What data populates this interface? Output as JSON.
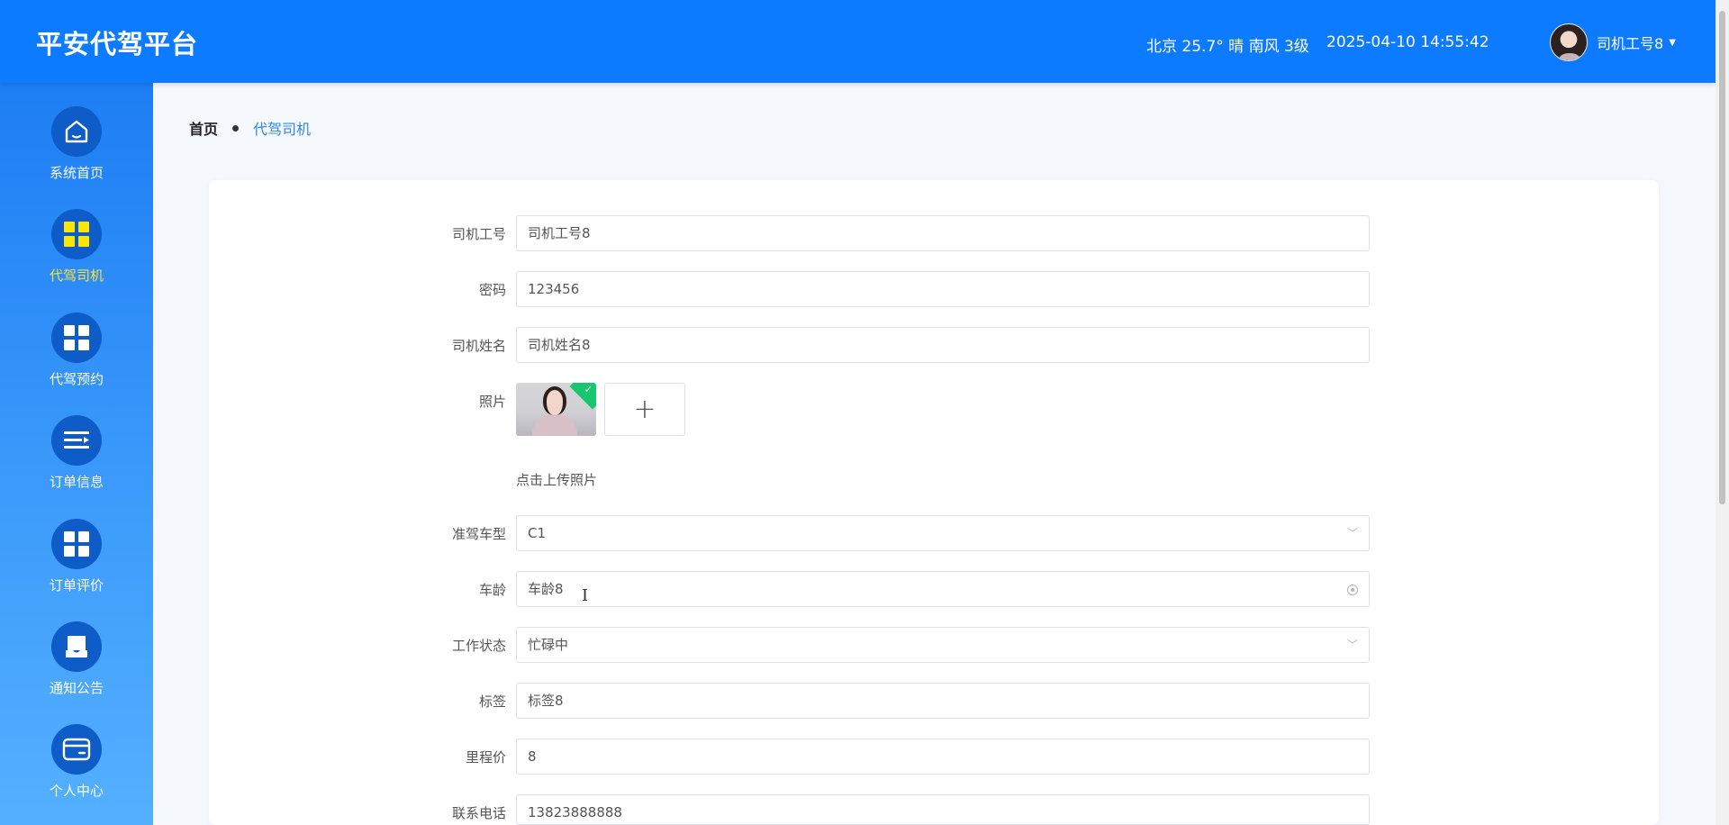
{
  "header": {
    "logo": "平安代驾平台",
    "weather": "北京  25.7°  晴  南风  3级",
    "datetime": "2025-04-10 14:55:42",
    "user_name": "司机工号8"
  },
  "sidebar": {
    "items": [
      {
        "label": "系统首页",
        "icon": "home-icon"
      },
      {
        "label": "代驾司机",
        "icon": "grid-icon",
        "active": true
      },
      {
        "label": "代驾预约",
        "icon": "grid-icon"
      },
      {
        "label": "订单信息",
        "icon": "list-icon"
      },
      {
        "label": "订单评价",
        "icon": "grid-icon"
      },
      {
        "label": "通知公告",
        "icon": "notice-icon"
      },
      {
        "label": "个人中心",
        "icon": "wallet-icon"
      }
    ]
  },
  "breadcrumb": {
    "home": "首页",
    "current": "代驾司机"
  },
  "form": {
    "driver_no": {
      "label": "司机工号",
      "value": "司机工号8"
    },
    "password": {
      "label": "密码",
      "value": "123456"
    },
    "driver_name": {
      "label": "司机姓名",
      "value": "司机姓名8"
    },
    "photo": {
      "label": "照片",
      "hint": "点击上传照片"
    },
    "license_type": {
      "label": "准驾车型",
      "value": "C1"
    },
    "driving_years": {
      "label": "车龄",
      "value": "车龄8"
    },
    "work_status": {
      "label": "工作状态",
      "value": "忙碌中"
    },
    "tag": {
      "label": "标签",
      "value": "标签8"
    },
    "mileage_price": {
      "label": "里程价",
      "value": "8"
    },
    "phone": {
      "label": "联系电话",
      "value": "13823888888"
    }
  },
  "colors": {
    "primary": "#0d7bff",
    "active_nav_text": "#ffe135",
    "upload_success": "#19c56d"
  }
}
